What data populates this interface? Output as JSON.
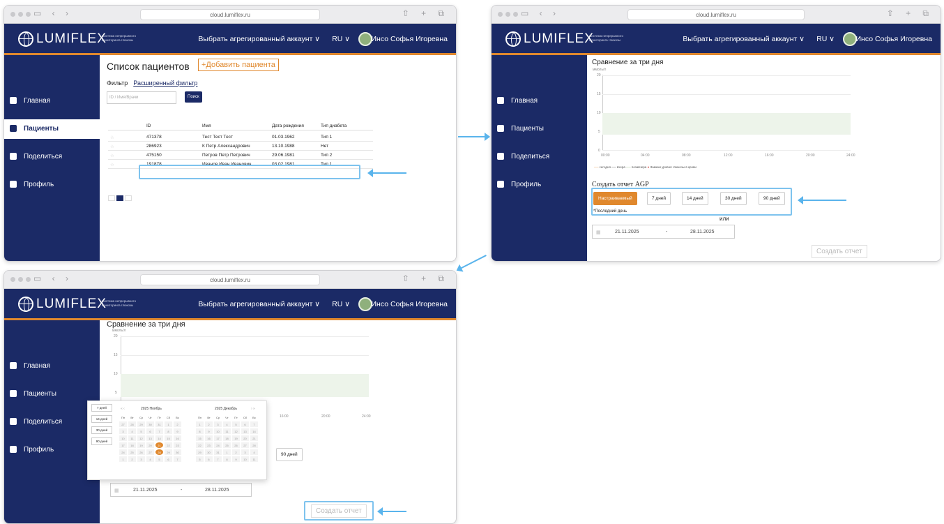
{
  "browser": {
    "url": "cloud.lumiflex.ru"
  },
  "header": {
    "logo": "LUMIFLEX",
    "tagline": "Система непрерывного мониторинга глюкозы",
    "account": "Выбрать агрегированный аккаунт ∨",
    "lang": "RU ∨",
    "user": "Инсо Софья Игоревна"
  },
  "sidebar": {
    "items": [
      {
        "label": "Главная"
      },
      {
        "label": "Пациенты"
      },
      {
        "label": "Поделиться"
      },
      {
        "label": "Профиль"
      }
    ]
  },
  "patients": {
    "title": "Список пациентов",
    "add": "+Добавить пациента",
    "filter": "Фильтр",
    "adv_filter": "Расширенный фильтр",
    "search_placeholder": "ID / Имя/Врачи",
    "search_btn": "Поиск",
    "columns": [
      "ID",
      "Имя",
      "Дата рождения",
      "Тип диабета"
    ],
    "rows": [
      [
        "471378",
        "Тест Тест Тест",
        "01.03.1962",
        "Тип 1"
      ],
      [
        "286923",
        "К Петр Александрович",
        "13.10.1988",
        "Нет"
      ],
      [
        "475150",
        "Петров Петр Петрович",
        "29.06.1981",
        "Тип 2"
      ],
      [
        "191878",
        "Иванов Иван Иванович",
        "03.02.1981",
        "Тип 1"
      ]
    ],
    "page": "1"
  },
  "report": {
    "title": "Сравнение за три дня",
    "unit": "ммоль/л",
    "y_ticks": [
      "20",
      "15",
      "10",
      "5",
      "0"
    ],
    "x_ticks": [
      "00:00",
      "04:00",
      "08:00",
      "12:00",
      "16:00",
      "20:00",
      "24:00"
    ],
    "legend": [
      "сегодня",
      "вчера",
      "позавчера",
      "Замеки уровня глюкозы в крови"
    ],
    "agp_title": "Создать отчет AGP",
    "custom": "Настраиваемый",
    "periods": [
      "7 дней",
      "14 дней",
      "30 дней",
      "90 дней"
    ],
    "last_day": "*Последний день",
    "or": "или",
    "date_from": "21.11.2025",
    "date_sep": "-",
    "date_to": "28.11.2025",
    "create": "Создать отчет"
  },
  "calendar": {
    "left_month": "2025 Ноябрь",
    "right_month": "2025 Декабрь",
    "weekdays": [
      "Пн",
      "Вт",
      "Ср",
      "Чт",
      "Пт",
      "Сб",
      "Вс"
    ],
    "left_days": [
      "27",
      "28",
      "29",
      "30",
      "31",
      "1",
      "2",
      "3",
      "4",
      "5",
      "6",
      "7",
      "8",
      "9",
      "10",
      "11",
      "12",
      "13",
      "14",
      "15",
      "16",
      "17",
      "18",
      "19",
      "20",
      "21",
      "22",
      "23",
      "24",
      "25",
      "26",
      "27",
      "28",
      "29",
      "30",
      "1",
      "2",
      "3",
      "4",
      "5",
      "6",
      "7"
    ],
    "right_days": [
      "1",
      "2",
      "3",
      "4",
      "5",
      "6",
      "7",
      "8",
      "9",
      "10",
      "11",
      "12",
      "13",
      "14",
      "15",
      "16",
      "17",
      "18",
      "19",
      "20",
      "21",
      "22",
      "23",
      "24",
      "25",
      "26",
      "27",
      "28",
      "29",
      "30",
      "31",
      "1",
      "2",
      "3",
      "4",
      "5",
      "6",
      "7",
      "8",
      "9",
      "10",
      "11"
    ],
    "quick": [
      "7 дней",
      "14 дней",
      "30 дней",
      "90 дней"
    ]
  }
}
